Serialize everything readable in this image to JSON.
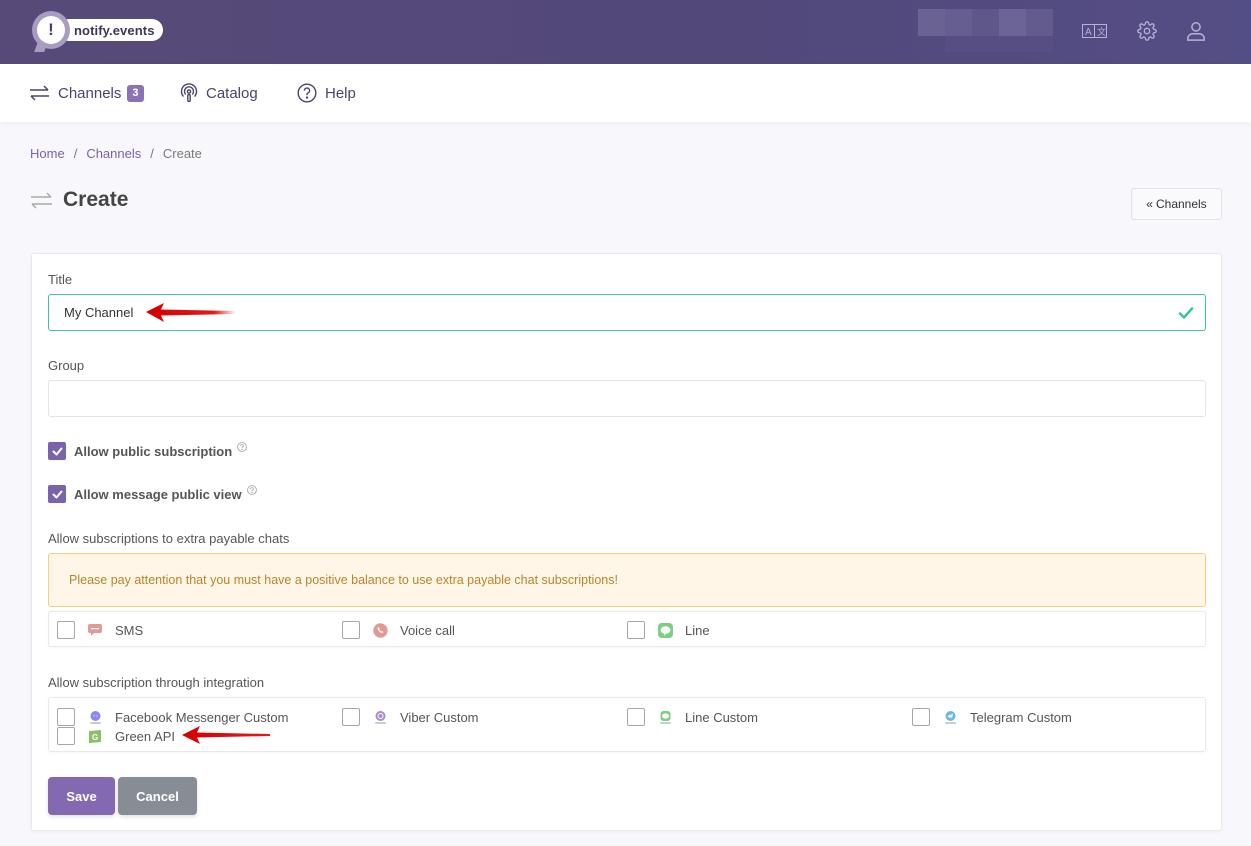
{
  "header": {
    "logo_text": "notify.events",
    "logo_glyph": "!",
    "icons": [
      "translate-icon",
      "gear-icon",
      "user-icon"
    ]
  },
  "nav": {
    "items": [
      {
        "label": "Channels",
        "icon": "exchange-arrows-icon",
        "badge": "3"
      },
      {
        "label": "Catalog",
        "icon": "podcast-icon"
      },
      {
        "label": "Help",
        "icon": "question-circle-icon"
      }
    ]
  },
  "breadcrumb": {
    "items": [
      "Home",
      "Channels",
      "Create"
    ],
    "separator": "/"
  },
  "page": {
    "title": "Create",
    "back_button": "Channels",
    "back_glyph": "«"
  },
  "form": {
    "title_label": "Title",
    "title_value": "My Channel",
    "group_label": "Group",
    "group_value": "",
    "allow_public_subscription": {
      "label": "Allow public subscription",
      "checked": true
    },
    "allow_message_public_view": {
      "label": "Allow message public view",
      "checked": true
    },
    "payable_label": "Allow subscriptions to extra payable chats",
    "payable_alert": "Please pay attention that you must have a positive balance to use extra payable chat subscriptions!",
    "payable_options": [
      {
        "label": "SMS",
        "icon": "sms-icon",
        "checked": false,
        "color": "#e29a97"
      },
      {
        "label": "Voice call",
        "icon": "phone-icon",
        "checked": false,
        "color": "#e29a97"
      },
      {
        "label": "Line",
        "icon": "line-icon",
        "checked": false,
        "color": "#7ccf7f"
      }
    ],
    "integration_label": "Allow subscription through integration",
    "integration_options": [
      {
        "label": "Facebook Messenger Custom",
        "icon": "messenger-icon",
        "checked": false,
        "color": "#8e86f2"
      },
      {
        "label": "Viber Custom",
        "icon": "viber-icon",
        "checked": false,
        "color": "#a98bd0"
      },
      {
        "label": "Line Custom",
        "icon": "line-icon",
        "checked": false,
        "color": "#7ccf7f"
      },
      {
        "label": "Telegram Custom",
        "icon": "telegram-icon",
        "checked": false,
        "color": "#6bb7e6"
      },
      {
        "label": "Green API",
        "icon": "green-api-icon",
        "checked": false,
        "color": "#8cbf6a",
        "glyph": "G"
      }
    ],
    "save_label": "Save",
    "cancel_label": "Cancel"
  },
  "colors": {
    "brand": "#574a78",
    "accent": "#7b62ad",
    "valid": "#3fc2a8",
    "warning_text": "#b6862b",
    "annotation_arrow": "#e00000"
  }
}
